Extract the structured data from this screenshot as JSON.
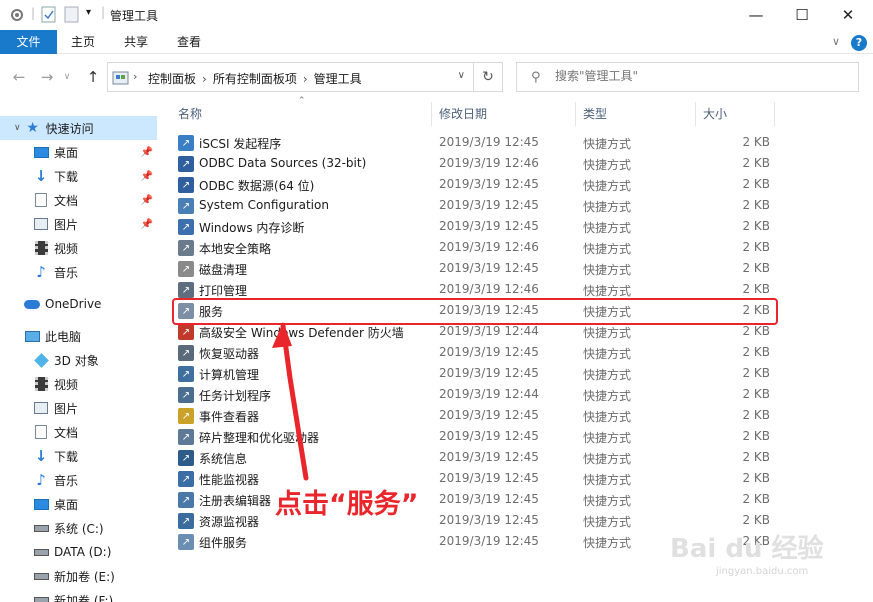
{
  "window": {
    "title": "管理工具",
    "minimize": "—",
    "maximize": "☐",
    "close": "✕"
  },
  "ribbon": {
    "tabs": [
      "文件",
      "主页",
      "共享",
      "查看"
    ],
    "help": "?"
  },
  "address": {
    "crumbs": [
      "控制面板",
      "所有控制面板项",
      "管理工具"
    ],
    "search_placeholder": "搜索\"管理工具\""
  },
  "nav": {
    "items": [
      {
        "label": "快速访问",
        "icon": "star-icon",
        "pinned": false,
        "selected": true
      },
      {
        "label": "桌面",
        "icon": "desktop-icon",
        "pinned": true
      },
      {
        "label": "下载",
        "icon": "download-icon",
        "pinned": true
      },
      {
        "label": "文档",
        "icon": "document-icon",
        "pinned": true
      },
      {
        "label": "图片",
        "icon": "picture-icon",
        "pinned": true
      },
      {
        "label": "视频",
        "icon": "video-icon",
        "pinned": false
      },
      {
        "label": "音乐",
        "icon": "music-icon",
        "pinned": false
      },
      {
        "label": "OneDrive",
        "icon": "cloud-icon",
        "pinned": false
      },
      {
        "label": "此电脑",
        "icon": "computer-icon",
        "pinned": false
      },
      {
        "label": "3D 对象",
        "icon": "cube-icon",
        "pinned": false
      },
      {
        "label": "视频",
        "icon": "video-icon",
        "pinned": false
      },
      {
        "label": "图片",
        "icon": "picture-icon",
        "pinned": false
      },
      {
        "label": "文档",
        "icon": "document-icon",
        "pinned": false
      },
      {
        "label": "下载",
        "icon": "download-icon",
        "pinned": false
      },
      {
        "label": "音乐",
        "icon": "music-icon",
        "pinned": false
      },
      {
        "label": "桌面",
        "icon": "desktop-icon",
        "pinned": false
      },
      {
        "label": "系统 (C:)",
        "icon": "drive-icon",
        "pinned": false
      },
      {
        "label": "DATA (D:)",
        "icon": "drive-icon",
        "pinned": false
      },
      {
        "label": "新加卷 (E:)",
        "icon": "drive-icon",
        "pinned": false
      },
      {
        "label": "新加卷 (F:)",
        "icon": "drive-icon",
        "pinned": false
      }
    ]
  },
  "columns": {
    "name": "名称",
    "date": "修改日期",
    "type": "类型",
    "size": "大小"
  },
  "files": [
    {
      "name": "iSCSI 发起程序",
      "date": "2019/3/19 12:45",
      "type": "快捷方式",
      "size": "2 KB",
      "color": "#3a7ec6"
    },
    {
      "name": "ODBC Data Sources (32-bit)",
      "date": "2019/3/19 12:46",
      "type": "快捷方式",
      "size": "2 KB",
      "color": "#2f5f9e"
    },
    {
      "name": "ODBC 数据源(64 位)",
      "date": "2019/3/19 12:45",
      "type": "快捷方式",
      "size": "2 KB",
      "color": "#2f5f9e"
    },
    {
      "name": "System Configuration",
      "date": "2019/3/19 12:45",
      "type": "快捷方式",
      "size": "2 KB",
      "color": "#4a7fb5"
    },
    {
      "name": "Windows 内存诊断",
      "date": "2019/3/19 12:45",
      "type": "快捷方式",
      "size": "2 KB",
      "color": "#3d6fae"
    },
    {
      "name": "本地安全策略",
      "date": "2019/3/19 12:46",
      "type": "快捷方式",
      "size": "2 KB",
      "color": "#6b7b8c"
    },
    {
      "name": "磁盘清理",
      "date": "2019/3/19 12:45",
      "type": "快捷方式",
      "size": "2 KB",
      "color": "#8a8a8a"
    },
    {
      "name": "打印管理",
      "date": "2019/3/19 12:46",
      "type": "快捷方式",
      "size": "2 KB",
      "color": "#5e6e7e"
    },
    {
      "name": "服务",
      "date": "2019/3/19 12:45",
      "type": "快捷方式",
      "size": "2 KB",
      "color": "#7d8fa6"
    },
    {
      "name": "高级安全 Windows Defender 防火墙",
      "date": "2019/3/19 12:44",
      "type": "快捷方式",
      "size": "2 KB",
      "color": "#c0392b"
    },
    {
      "name": "恢复驱动器",
      "date": "2019/3/19 12:45",
      "type": "快捷方式",
      "size": "2 KB",
      "color": "#5a6a7a"
    },
    {
      "name": "计算机管理",
      "date": "2019/3/19 12:45",
      "type": "快捷方式",
      "size": "2 KB",
      "color": "#3f6f9f"
    },
    {
      "name": "任务计划程序",
      "date": "2019/3/19 12:44",
      "type": "快捷方式",
      "size": "2 KB",
      "color": "#4b6d8f"
    },
    {
      "name": "事件查看器",
      "date": "2019/3/19 12:45",
      "type": "快捷方式",
      "size": "2 KB",
      "color": "#c9a227"
    },
    {
      "name": "碎片整理和优化驱动器",
      "date": "2019/3/19 12:45",
      "type": "快捷方式",
      "size": "2 KB",
      "color": "#5f7a96"
    },
    {
      "name": "系统信息",
      "date": "2019/3/19 12:45",
      "type": "快捷方式",
      "size": "2 KB",
      "color": "#2e5c8a"
    },
    {
      "name": "性能监视器",
      "date": "2019/3/19 12:45",
      "type": "快捷方式",
      "size": "2 KB",
      "color": "#3b6ea5"
    },
    {
      "name": "注册表编辑器",
      "date": "2019/3/19 12:45",
      "type": "快捷方式",
      "size": "2 KB",
      "color": "#4a78a8"
    },
    {
      "name": "资源监视器",
      "date": "2019/3/19 12:45",
      "type": "快捷方式",
      "size": "2 KB",
      "color": "#3a6d9e"
    },
    {
      "name": "组件服务",
      "date": "2019/3/19 12:45",
      "type": "快捷方式",
      "size": "2 KB",
      "color": "#6a8fb3"
    }
  ],
  "annotation": {
    "text": "点击“服务”",
    "color": "#e8262b"
  },
  "watermark": {
    "brand": "Bai du 经验",
    "url": "jingyan.baidu.com"
  }
}
